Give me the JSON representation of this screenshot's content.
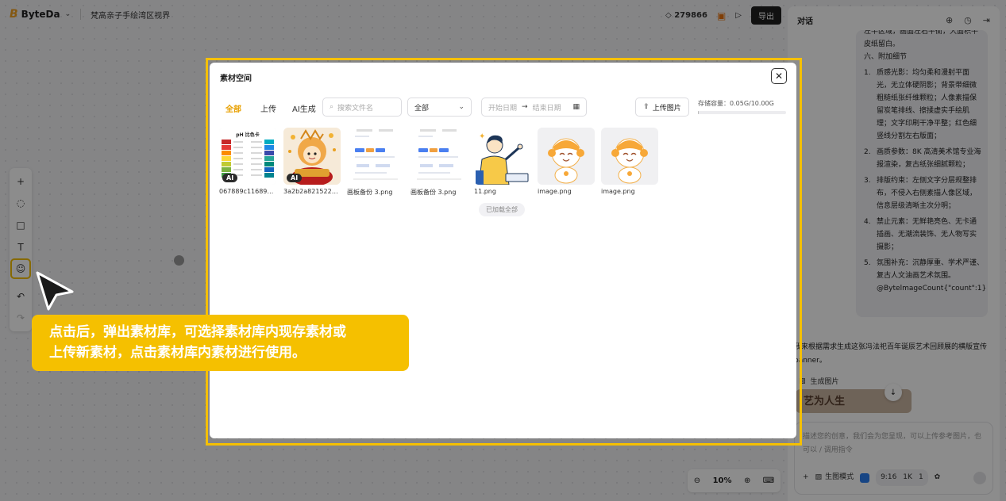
{
  "topbar": {
    "logo": "ByteDa",
    "project_title": "梵高亲子手绘湾区视界",
    "credits": "279866",
    "export_label": "导出"
  },
  "chat": {
    "title": "对话",
    "bubble_lines": [
      "左半区域，画面左右平衡，大面积牛",
      "皮纸留白。",
      "六、附加细节"
    ],
    "bubble_items": [
      {
        "num": "1.",
        "text": "质感光影：均匀柔和漫射平面光，无立体硬阴影；背景带细微粗糙纸张纤维颗粒；人像素描保留炭笔排线、擦揉虚实手绘肌理；文字印刷干净平整；红色细竖线分割左右版面；"
      },
      {
        "num": "2.",
        "text": "画质参数：8K 高清美术馆专业海报渲染，复古纸张细腻颗粒；"
      },
      {
        "num": "3.",
        "text": "排版约束：左侧文字分层规整排布，不侵入右侧素描人像区域，信息层级清晰主次分明；"
      },
      {
        "num": "4.",
        "text": "禁止元素：无鲜艳亮色、无卡通插画、无潮流装饰、无人物写实摄影；"
      },
      {
        "num": "5.",
        "text": "氛围补充：沉静厚重、学术严谨、复古人文油画艺术氛围。@BytelmageCount{\"count\":1}"
      }
    ],
    "reply": "我来根据需求生成这张冯法祀百年诞辰艺术回顾展的横版宣传 banner。",
    "gen_label": "生成图片",
    "thumb_text": "艺为人生",
    "input_placeholder": "描述您的创意，我们会为您呈现，可以上传参考图片，也可以 / 调用指令",
    "mode_label": "生图模式",
    "ratio": "9:16",
    "resolution": "1K",
    "count": "1"
  },
  "zoom": {
    "level": "10%"
  },
  "modal": {
    "title": "素材空间",
    "tabs": [
      "全部",
      "上传",
      "AI生成"
    ],
    "search_placeholder": "搜索文件名",
    "filter_value": "全部",
    "date_start": "开始日期",
    "date_end": "结束日期",
    "upload_label": "上传图片",
    "storage_label": "存储容量：",
    "storage_value": "0.05G/10.00G",
    "storage_used_fraction": 0.005,
    "assets": [
      {
        "name": "067889c1168948…",
        "ai": "AI",
        "kind": "ph-chart",
        "chart_title": "pH 比色卡"
      },
      {
        "name": "3a2b2a82152247…",
        "ai": "AI",
        "kind": "mascot-red"
      },
      {
        "name": "画板备份 3.png",
        "kind": "dashboard"
      },
      {
        "name": "画板备份 3.png",
        "kind": "dashboard"
      },
      {
        "name": "11.png",
        "kind": "person"
      },
      {
        "name": "image.png",
        "kind": "robot"
      },
      {
        "name": "image.png",
        "kind": "robot"
      }
    ],
    "loaded_all": "已加载全部"
  },
  "callout": {
    "line1": "点击后，弹出素材库，可选择素材库内现存素材或",
    "line2": "上传新素材，点击素材库内素材进行使用。"
  },
  "colors": {
    "accent": "#f5c000",
    "tab_active": "#e8a000"
  }
}
